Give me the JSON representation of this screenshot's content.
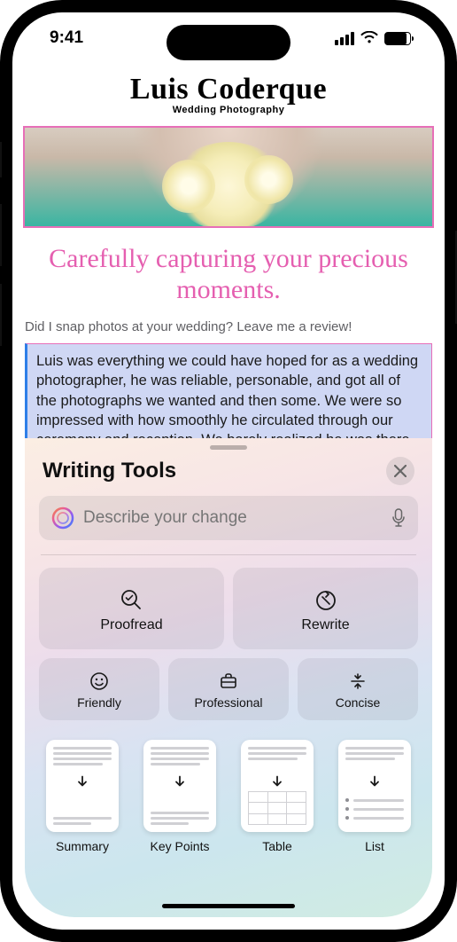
{
  "status": {
    "time": "9:41"
  },
  "brand": {
    "name": "Luis Coderque",
    "subtitle": "Wedding Photography"
  },
  "page": {
    "headline": "Carefully capturing your precious moments.",
    "prompt": "Did I snap photos at your wedding? Leave me a review!",
    "review_text": "Luis was everything we could have hoped for as a wedding photographer, he was reliable, personable, and got all of the photographs we wanted and then some. We were so impressed with how smoothly he circulated through our ceremony and reception. We barely realized he was there except when he was very"
  },
  "sheet": {
    "title": "Writing Tools",
    "input_placeholder": "Describe your change",
    "tools": {
      "proofread": "Proofread",
      "rewrite": "Rewrite",
      "friendly": "Friendly",
      "professional": "Professional",
      "concise": "Concise"
    },
    "transforms": {
      "summary": "Summary",
      "key_points": "Key Points",
      "table": "Table",
      "list": "List"
    }
  }
}
